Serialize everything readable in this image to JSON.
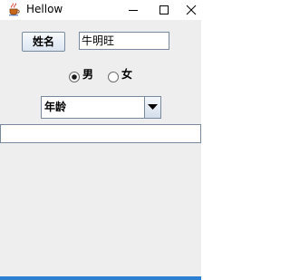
{
  "window": {
    "title": "Hellow",
    "app_icon": "java-cup-icon"
  },
  "controls": {
    "minimize_icon": "minimize-icon",
    "maximize_icon": "maximize-icon",
    "close_icon": "close-icon"
  },
  "form": {
    "name_button_label": "姓名",
    "name_value": "牛明旺",
    "gender": {
      "male_label": "男",
      "female_label": "女",
      "selected": "男"
    },
    "age_select": {
      "selected": "年龄"
    },
    "text_field_value": ""
  },
  "colors": {
    "client_bg": "#eeeeee",
    "accent": "#2d7fd3",
    "border": "#7a8a9e"
  }
}
